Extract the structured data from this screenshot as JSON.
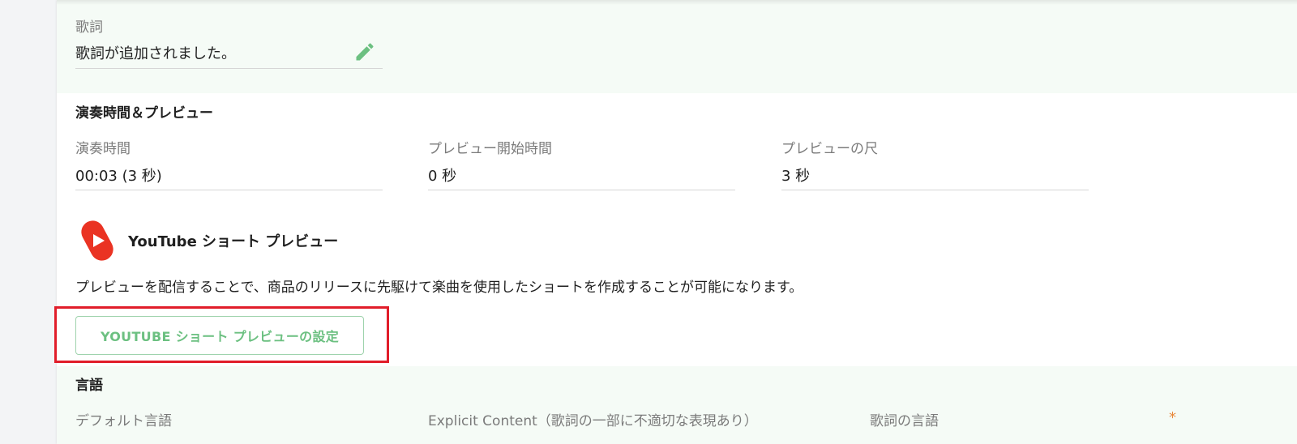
{
  "lyrics": {
    "label": "歌詞",
    "value": "歌詞が追加されました。",
    "edit_icon": "pencil-icon"
  },
  "duration_section": {
    "title": "演奏時間＆プレビュー",
    "fields": [
      {
        "label": "演奏時間",
        "value": "00:03 (3 秒)"
      },
      {
        "label": "プレビュー開始時間",
        "value": "0 秒"
      },
      {
        "label": "プレビューの尺",
        "value": "3 秒"
      }
    ]
  },
  "youtube_shorts": {
    "logo_icon": "youtube-shorts-icon",
    "title": "YouTube ショート プレビュー",
    "description": "プレビューを配信することで、商品のリリースに先駆けて楽曲を使用したショートを作成することが可能になります。",
    "button_label": "YOUTUBE ショート プレビューの設定"
  },
  "language_section": {
    "title": "言語",
    "default_language_label": "デフォルト言語",
    "explicit_content_label": "Explicit Content（歌詞の一部に不適切な表現あり）",
    "lyrics_language_label": "歌詞の言語",
    "required_marker": "*"
  },
  "colors": {
    "accent_green": "#6cc081",
    "section_tint": "#f5fbf6",
    "highlight_red": "#e11d2a",
    "youtube_red": "#ea3323",
    "required_orange": "#e8873a"
  }
}
